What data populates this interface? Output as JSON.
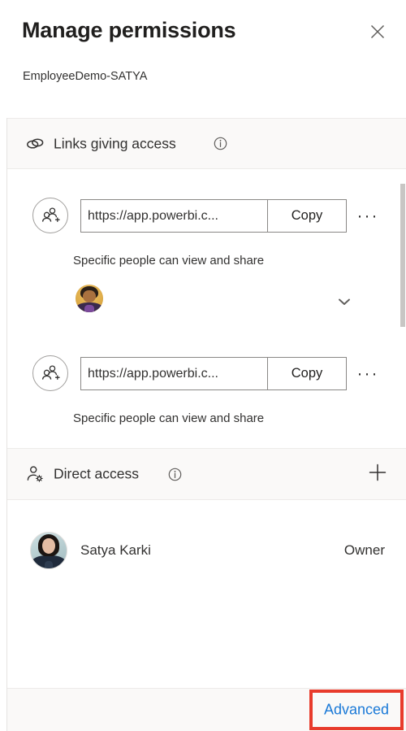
{
  "header": {
    "title": "Manage permissions",
    "subtitle": "EmployeeDemo-SATYA",
    "close_icon": "close-icon"
  },
  "links_section": {
    "icon": "link-chain-icon",
    "label": "Links giving access",
    "info_icon": "info-icon",
    "rows": [
      {
        "avatar_icon": "people-add-icon",
        "url": "https://app.powerbi.c...",
        "url_placeholder": "https://app.powerbi.c...",
        "copy_label": "Copy",
        "more_label": "···",
        "caption": "Specific people can view and share",
        "has_people": true,
        "people": [
          {
            "name": "shared-person-avatar"
          }
        ],
        "expand_icon": "chevron-down-icon"
      },
      {
        "avatar_icon": "people-add-icon",
        "url": "https://app.powerbi.c...",
        "url_placeholder": "https://app.powerbi.c...",
        "copy_label": "Copy",
        "more_label": "···",
        "caption": "Specific people can view and share",
        "has_people": false
      }
    ]
  },
  "direct_access_section": {
    "icon": "person-settings-icon",
    "label": "Direct access",
    "info_icon": "info-icon",
    "add_icon": "plus-icon",
    "rows": [
      {
        "avatar": "user-photo-avatar",
        "name": "Satya Karki",
        "role": "Owner"
      }
    ]
  },
  "footer": {
    "advanced_label": "Advanced"
  },
  "colors": {
    "link_blue": "#1a79d7",
    "highlight_red": "#e83b2c",
    "band_background": "#faf9f8",
    "text_primary": "#323130",
    "border": "#8a8886"
  }
}
